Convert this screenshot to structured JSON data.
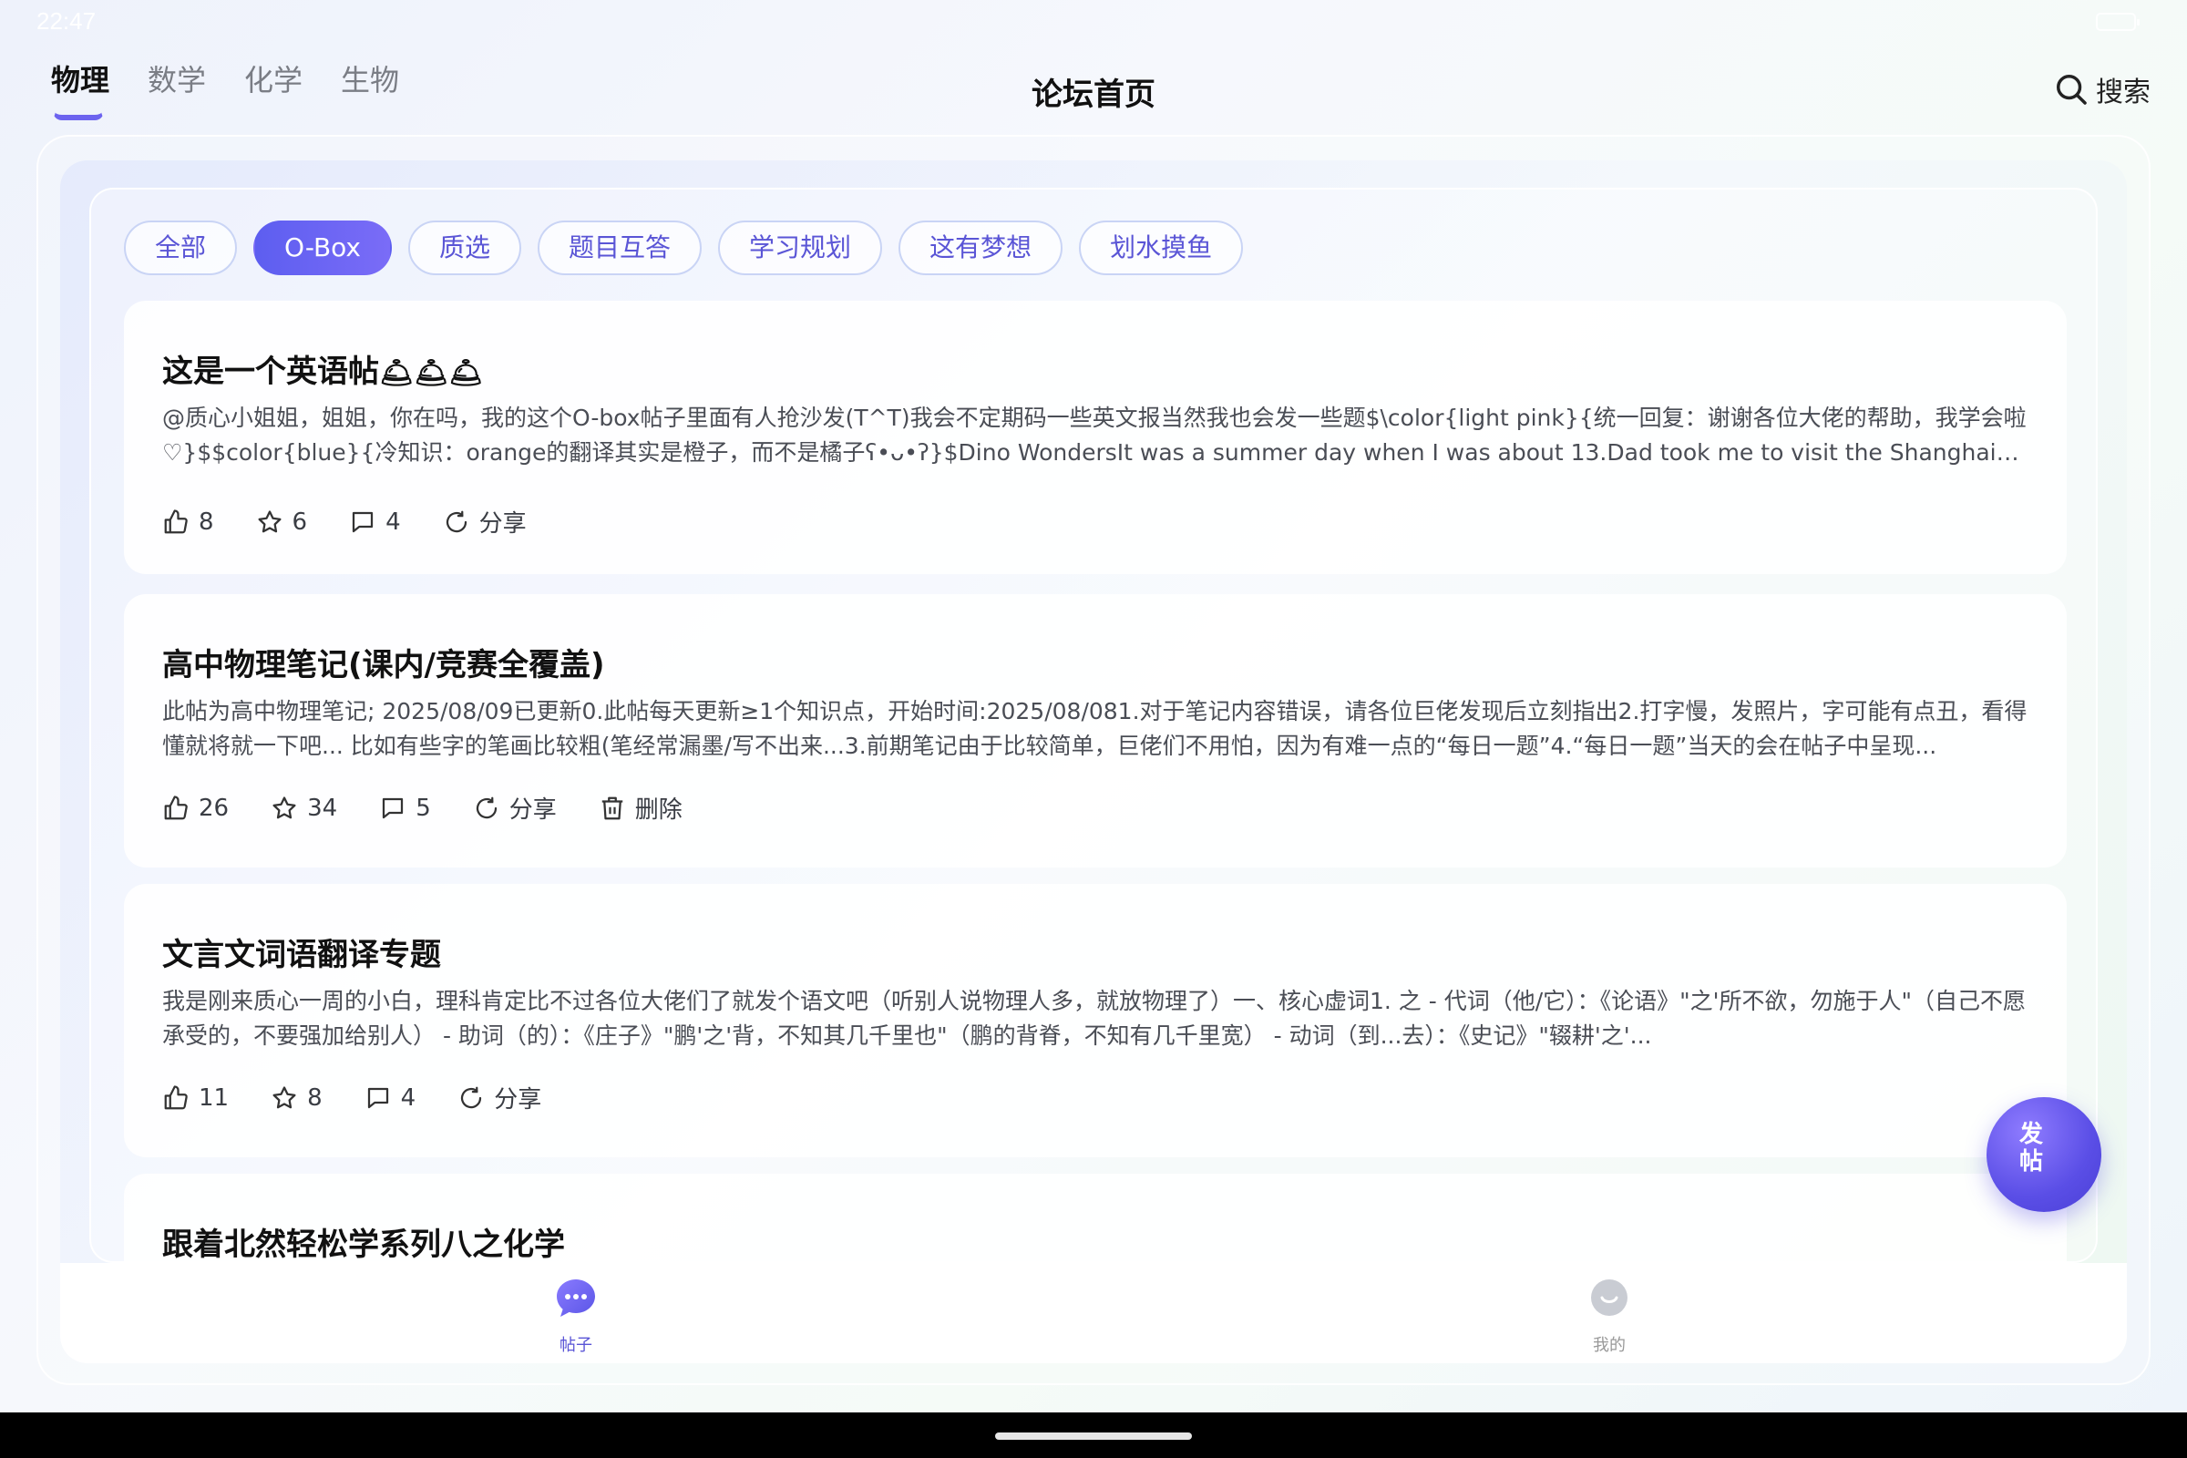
{
  "status_bar": {
    "time": "22:47"
  },
  "header": {
    "subject_tabs": [
      {
        "label": "物理",
        "active": true
      },
      {
        "label": "数学",
        "active": false
      },
      {
        "label": "化学",
        "active": false
      },
      {
        "label": "生物",
        "active": false
      }
    ],
    "title": "论坛首页",
    "search_label": "搜索"
  },
  "categories": [
    {
      "label": "全部",
      "active": false
    },
    {
      "label": "O-Box",
      "active": true
    },
    {
      "label": "质选",
      "active": false
    },
    {
      "label": "题目互答",
      "active": false
    },
    {
      "label": "学习规划",
      "active": false
    },
    {
      "label": "这有梦想",
      "active": false
    },
    {
      "label": "划水摸鱼",
      "active": false
    }
  ],
  "posts": [
    {
      "title": "这是一个英语帖",
      "title_emoji": "🛎🛎🛎",
      "excerpt": "@质心小姐姐，姐姐，你在吗，我的这个O-box帖子里面有人抢沙发(T^T)我会不定期码一些英文报当然我也会发一些题$\\color{light pink}{统一回复：谢谢各位大佬的帮助，我学会啦♡}$$color{blue}{冷知识：orange的翻译其实是橙子，而不是橘子ʕ•ᴗ•ʔ}$Dino WondersIt was a summer day when I was about 13.Dad took me to visit the Shanghai Natural History Museum...",
      "likes": "8",
      "stars": "6",
      "comments": "4",
      "share_label": "分享"
    },
    {
      "title": "高中物理笔记(课内/竞赛全覆盖)",
      "excerpt": "此帖为高中物理笔记; 2025/08/09已更新0.此帖每天更新≥1个知识点，开始时间:2025/08/081.对于笔记内容错误，请各位巨佬发现后立刻指出2.打字慢，发照片，字可能有点丑，看得懂就将就一下吧...   比如有些字的笔画比较粗(笔经常漏墨/写不出来...3.前期笔记由于比较简单，巨佬们不用怕，因为有难一点的“每日一题”4.“每日一题”当天的会在帖子中呈现...",
      "likes": "26",
      "stars": "34",
      "comments": "5",
      "share_label": "分享",
      "delete_label": "删除"
    },
    {
      "title": "文言文词语翻译专题",
      "excerpt": "我是刚来质心一周的小白，理科肯定比不过各位大佬们了就发个语文吧（听别人说物理人多，就放物理了）一、核心虚词1. 之   - 代词（他/它）：《论语》\"之'所不欲，勿施于人\"（自己不愿承受的，不要强加给别人）             - 助词（的）：《庄子》\"鹏'之'背，不知其几千里也\"（鹏的背脊，不知有几千里宽）          - 动词（到...去）：《史记》\"辍耕'之'...",
      "likes": "11",
      "stars": "8",
      "comments": "4",
      "share_label": "分享"
    },
    {
      "title": "跟着北然轻松学系列八之化学"
    }
  ],
  "bottom_nav": [
    {
      "label": "帖子",
      "active": true
    },
    {
      "label": "我的",
      "active": false
    }
  ],
  "fab": {
    "label": "发帖"
  },
  "colors": {
    "accent": "#5d5ef0",
    "accent_light": "#c9d4f5",
    "text": "#1a1a1a",
    "muted": "#7a7d85"
  }
}
